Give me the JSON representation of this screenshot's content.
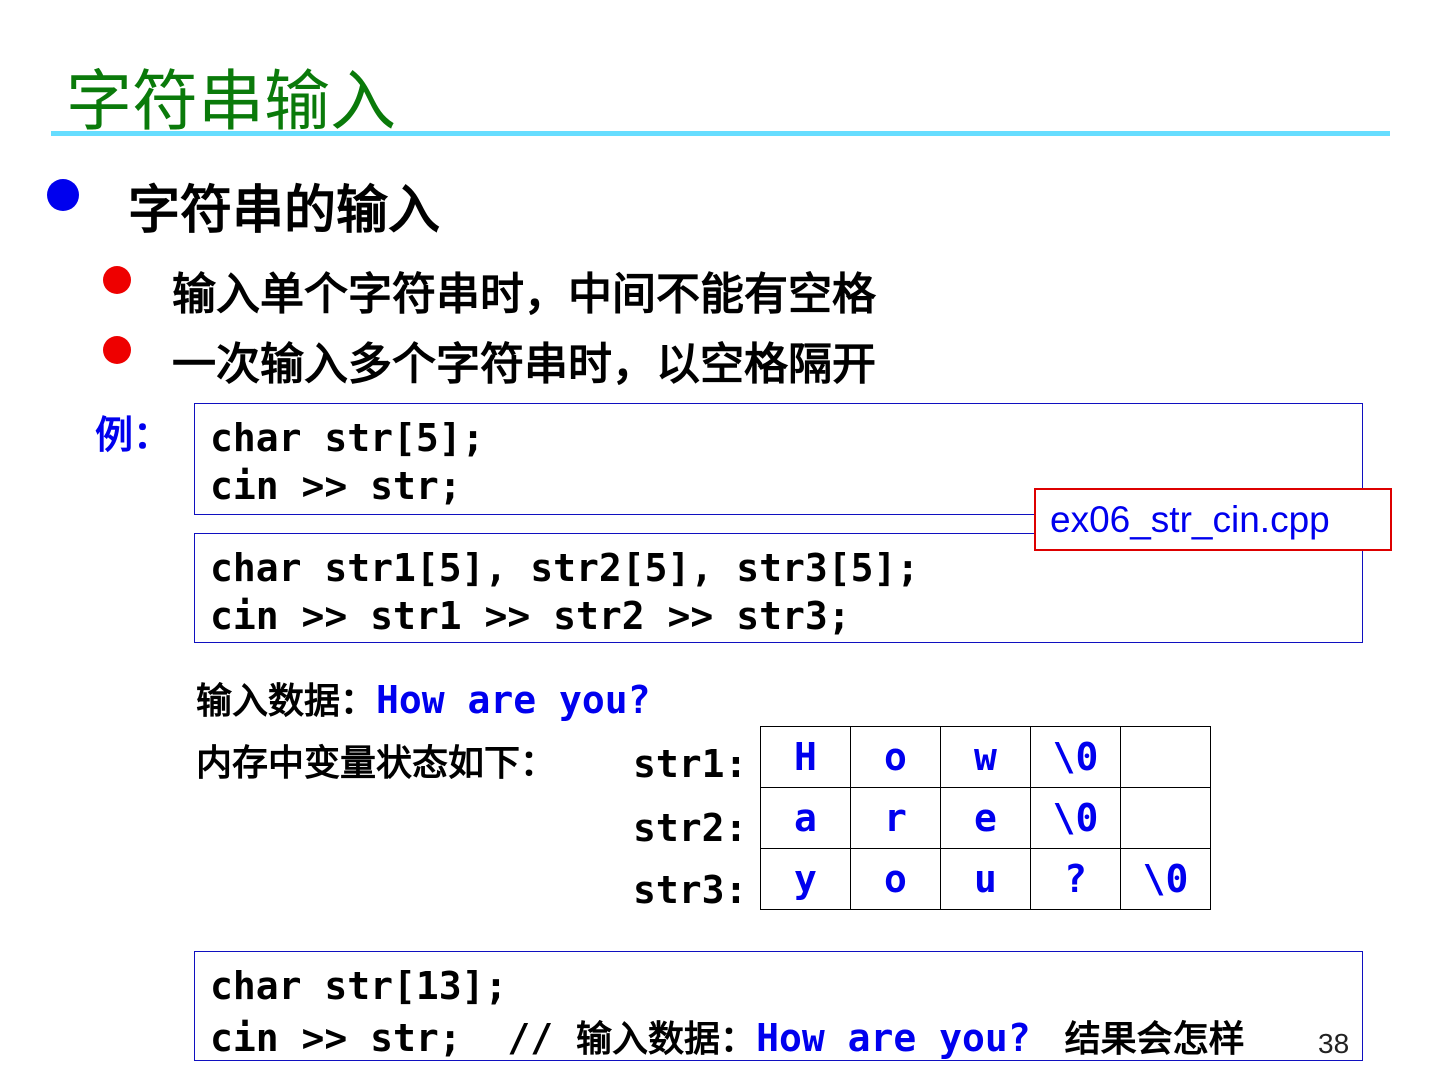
{
  "title": "字符串输入",
  "bullet1": "字符串的输入",
  "sub_bullets": [
    "输入单个字符串时，中间不能有空格",
    "一次输入多个字符串时，以空格隔开"
  ],
  "example_label": "例：",
  "code1": [
    "char str[5];",
    "cin >> str;"
  ],
  "callout": "ex06_str_cin.cpp",
  "code2": [
    "char str1[5], str2[5], str3[5];",
    "cin >> str1 >> str2 >> str3;"
  ],
  "input_label": "输入数据：",
  "input_value": "How are you?",
  "memory_label": "内存中变量状态如下：",
  "memory": [
    {
      "name": "str1:",
      "cells": [
        "H",
        "o",
        "w",
        "\\0",
        ""
      ]
    },
    {
      "name": "str2:",
      "cells": [
        "a",
        "r",
        "e",
        "\\0",
        ""
      ]
    },
    {
      "name": "str3:",
      "cells": [
        "y",
        "o",
        "u",
        "?",
        "\\0"
      ]
    }
  ],
  "code3": {
    "line1": "char str[13];",
    "line2_code": "cin >> str;  // ",
    "line2_label": "输入数据：",
    "line2_value": "How are you?",
    "line2_question": "结果会怎样"
  },
  "page_number": "38"
}
